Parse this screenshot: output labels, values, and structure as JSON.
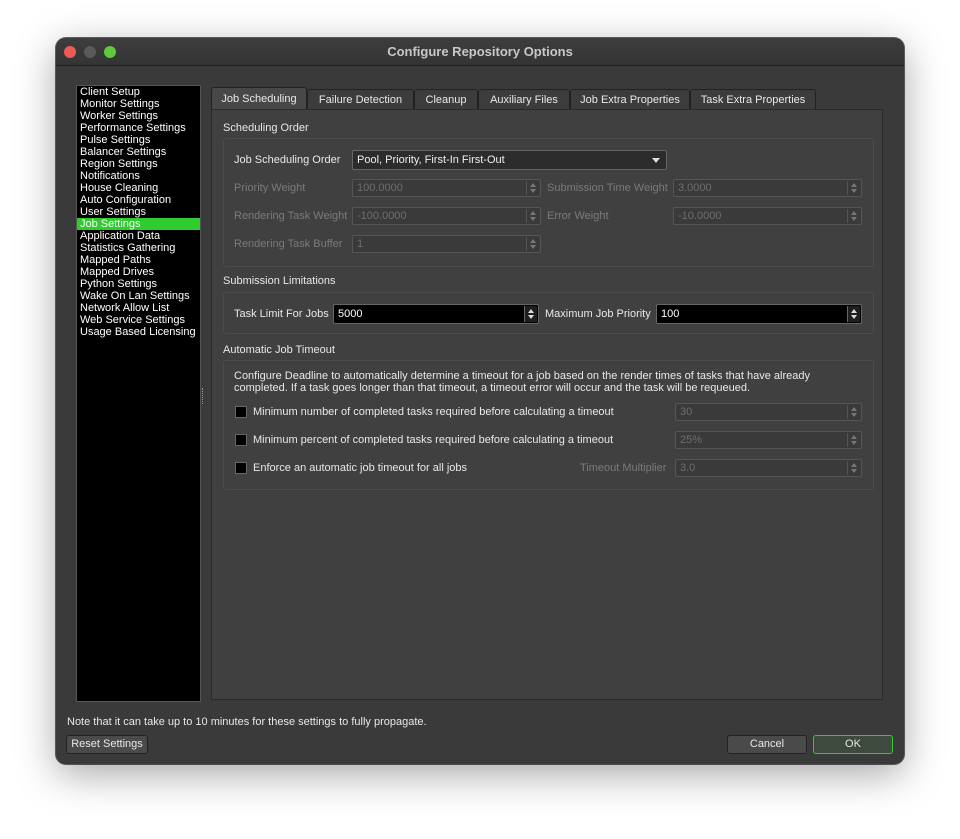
{
  "window": {
    "title": "Configure Repository Options"
  },
  "sidebar": {
    "items": [
      "Client Setup",
      "Monitor Settings",
      "Worker Settings",
      "Performance Settings",
      "Pulse Settings",
      "Balancer Settings",
      "Region Settings",
      "Notifications",
      "House Cleaning",
      "Auto Configuration",
      "User Settings",
      "Job Settings",
      "Application Data",
      "Statistics Gathering",
      "Mapped Paths",
      "Mapped Drives",
      "Python Settings",
      "Wake On Lan Settings",
      "Network Allow List",
      "Web Service Settings",
      "Usage Based Licensing"
    ],
    "selected": "Job Settings"
  },
  "tabs": [
    "Job Scheduling",
    "Failure Detection",
    "Cleanup",
    "Auxiliary Files",
    "Job Extra Properties",
    "Task Extra Properties"
  ],
  "active_tab": "Job Scheduling",
  "scheduling": {
    "section": "Scheduling Order",
    "order_label": "Job Scheduling Order",
    "order_value": "Pool, Priority, First-In First-Out",
    "priority_weight_label": "Priority Weight",
    "priority_weight": "100.0000",
    "submission_time_weight_label": "Submission Time Weight",
    "submission_time_weight": "3.0000",
    "rendering_task_weight_label": "Rendering Task Weight",
    "rendering_task_weight": "-100.0000",
    "error_weight_label": "Error Weight",
    "error_weight": "-10.0000",
    "rendering_task_buffer_label": "Rendering Task Buffer",
    "rendering_task_buffer": "1"
  },
  "limitations": {
    "section": "Submission Limitations",
    "task_limit_label": "Task Limit For Jobs",
    "task_limit": "5000",
    "max_priority_label": "Maximum Job Priority",
    "max_priority": "100"
  },
  "timeout": {
    "section": "Automatic Job Timeout",
    "description": "Configure Deadline to automatically determine a timeout for a job based on the render times of tasks that have already completed. If a task goes longer than that timeout, a timeout error will occur and the task will be requeued.",
    "min_tasks_label": "Minimum number of completed tasks required before calculating a timeout",
    "min_tasks": "30",
    "min_percent_label": "Minimum percent of completed tasks required before calculating a timeout",
    "min_percent": "25%",
    "enforce_label": "Enforce an automatic job timeout for all jobs",
    "multiplier_label": "Timeout Multiplier",
    "multiplier": "3.0"
  },
  "footer": {
    "note": "Note that it can take up to 10 minutes for these settings to fully propagate.",
    "reset": "Reset Settings",
    "cancel": "Cancel",
    "ok": "OK"
  },
  "colors": {
    "selection": "#2ecc2e",
    "close": "#ee5b56",
    "maximize": "#5fc83c"
  }
}
